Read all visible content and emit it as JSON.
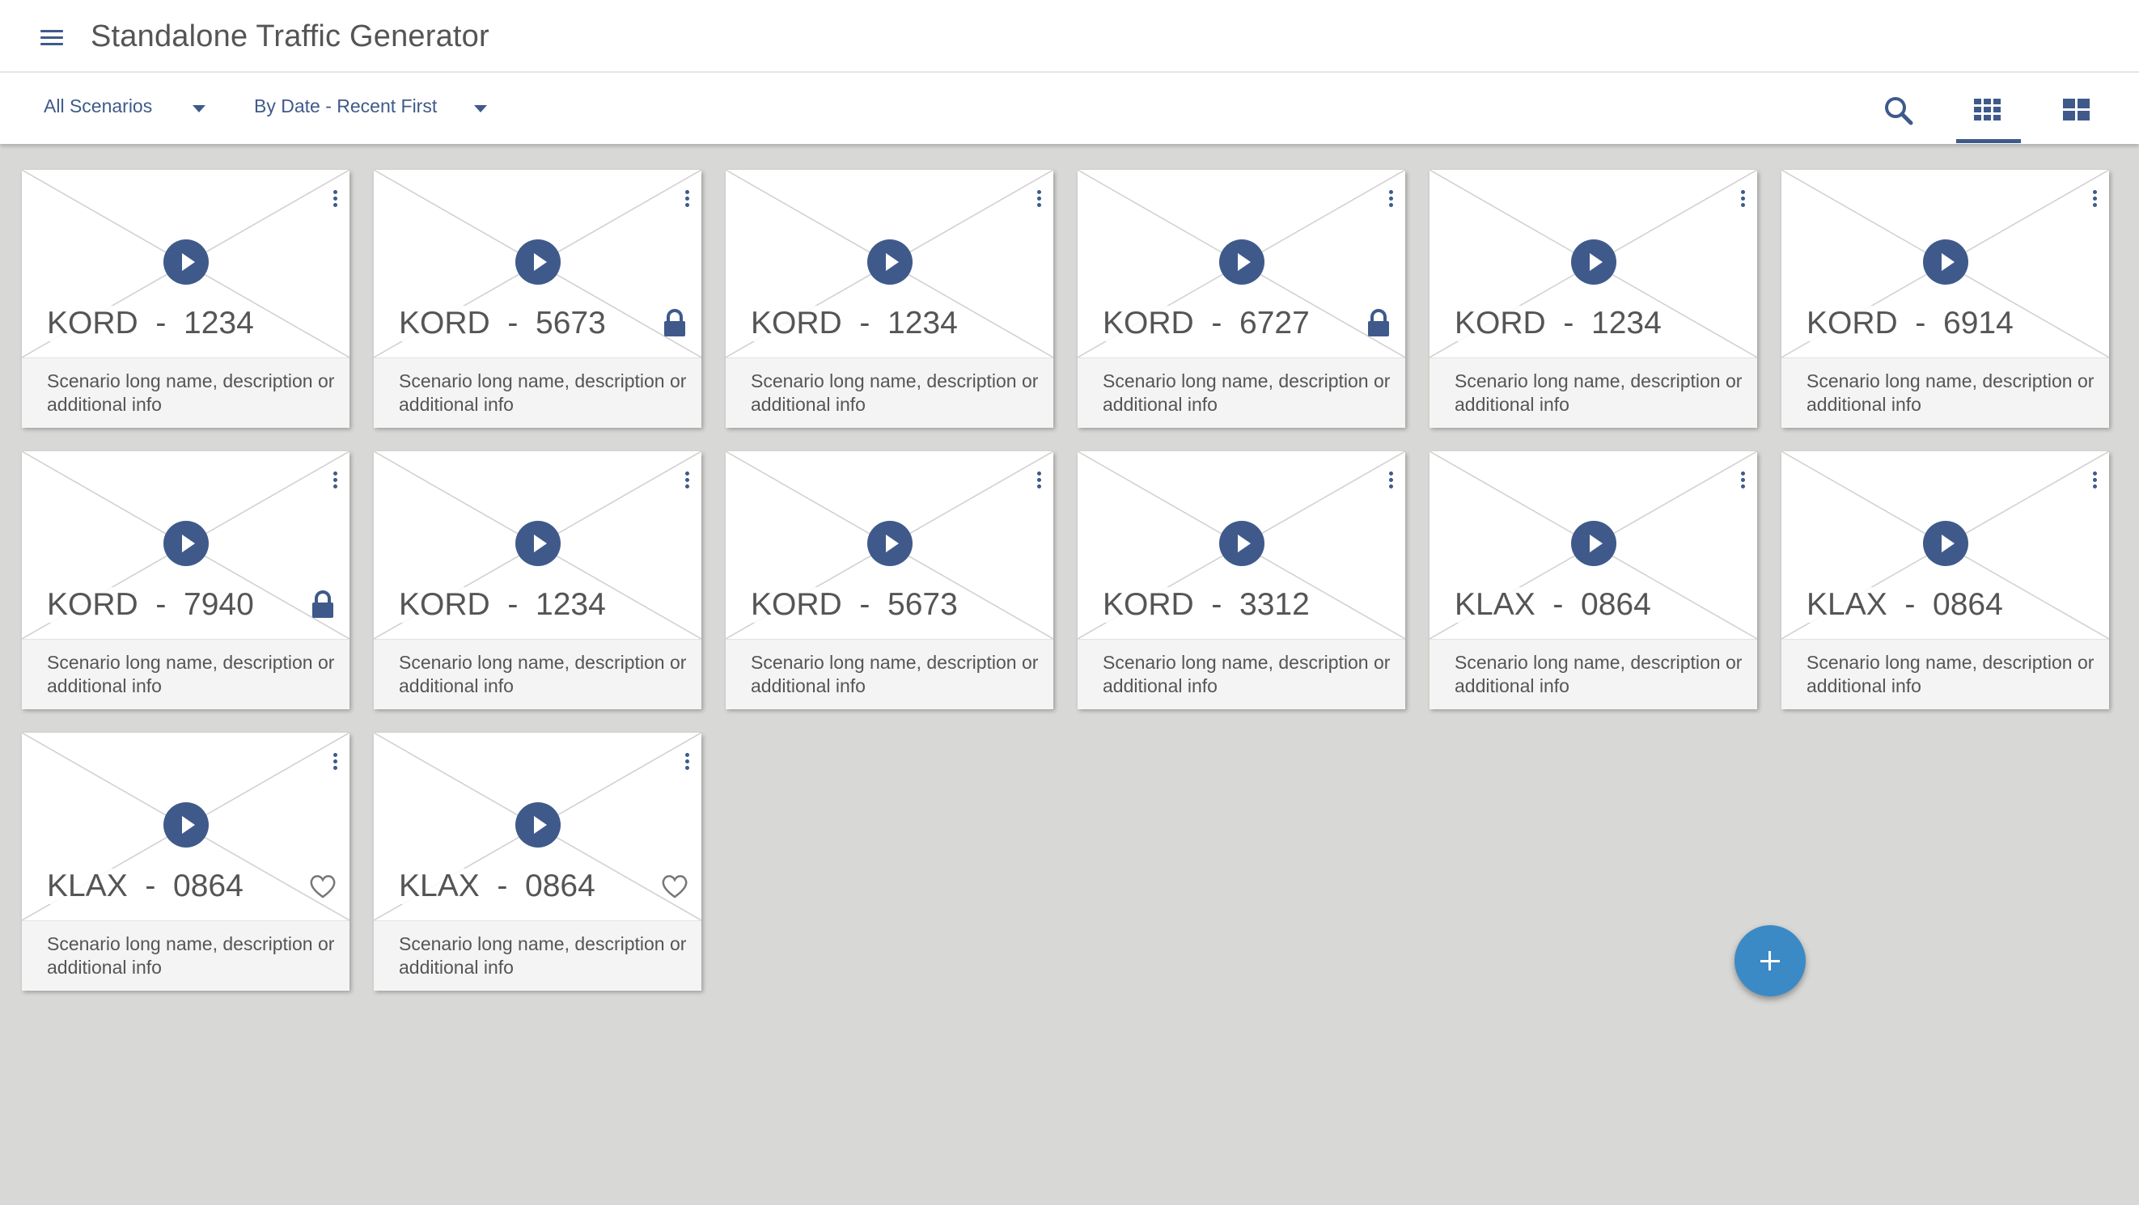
{
  "app": {
    "title": "Standalone Traffic Generator"
  },
  "toolbar": {
    "filter_label": "All Scenarios",
    "sort_label": "By Date - Recent First",
    "icons": [
      "search-icon",
      "grid-small-icon",
      "grid-large-icon"
    ],
    "active_view": "grid-small"
  },
  "colors": {
    "primary": "#3f5a8a",
    "fab": "#3b8ac6",
    "background": "#d8d8d6"
  },
  "cards": [
    {
      "title": "KORD  -  1234",
      "description": "Scenario long name, description or additional info",
      "badge": ""
    },
    {
      "title": "KORD  -  5673",
      "description": "Scenario long name, description or additional info",
      "badge": "lock"
    },
    {
      "title": "KORD  -  1234",
      "description": "Scenario long name, description or additional info",
      "badge": ""
    },
    {
      "title": "KORD  -  6727",
      "description": "Scenario long name, description or additional info",
      "badge": "lock"
    },
    {
      "title": "KORD  -  1234",
      "description": "Scenario long name, description or additional info",
      "badge": ""
    },
    {
      "title": "KORD  -  6914",
      "description": "Scenario long name, description or additional info",
      "badge": ""
    },
    {
      "title": "KORD  -  7940",
      "description": "Scenario long name, description or additional info",
      "badge": "lock"
    },
    {
      "title": "KORD  -  1234",
      "description": "Scenario long name, description or additional info",
      "badge": ""
    },
    {
      "title": "KORD  -  5673",
      "description": "Scenario long name, description or additional info",
      "badge": ""
    },
    {
      "title": "KORD  -  3312",
      "description": "Scenario long name, description or additional info",
      "badge": ""
    },
    {
      "title": "KLAX  -  0864",
      "description": "Scenario long name, description or additional info",
      "badge": ""
    },
    {
      "title": "KLAX  -  0864",
      "description": "Scenario long name, description or additional info",
      "badge": ""
    },
    {
      "title": "KLAX  -  0864",
      "description": "Scenario long name, description or additional info",
      "badge": "heart"
    },
    {
      "title": "KLAX  -  0864",
      "description": "Scenario long name, description or additional info",
      "badge": "heart"
    }
  ],
  "fab": {
    "icon": "plus-icon"
  }
}
